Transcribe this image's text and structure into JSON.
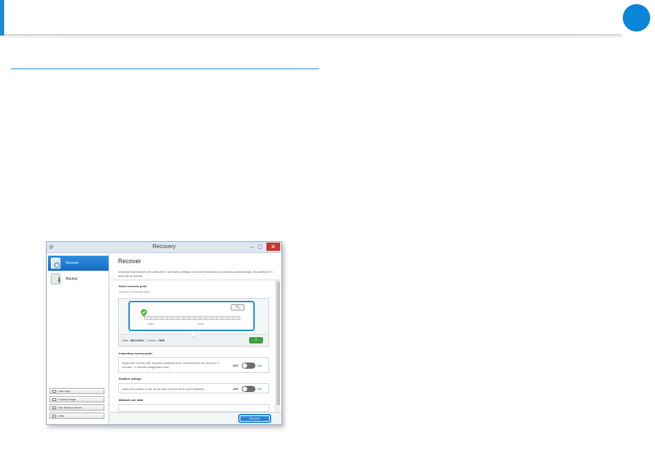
{
  "window": {
    "title": "Recovery",
    "controls": {
      "minimize": "–",
      "maximize": "□",
      "close": "✕"
    }
  },
  "sidebar": {
    "items": [
      {
        "label": "Recover",
        "icon": "recover-icon",
        "active": true
      },
      {
        "label": "Backup",
        "icon": "backup-icon",
        "active": false
      }
    ],
    "buttons": [
      {
        "label": "Disk copy"
      },
      {
        "label": "Factory image"
      },
      {
        "label": "Run Backup server"
      },
      {
        "label": "Help"
      }
    ]
  },
  "main": {
    "title": "Recover",
    "description": "A function that recovers the computer to the factory settings or recovers Windows to previously saved settings. All contents of C: drive will be deleted.",
    "select_point": {
      "title": "Select recovery point",
      "subtitle": "Recover to selected point.",
      "zoom_label": "🔍",
      "years": [
        "2012",
        "2013"
      ],
      "date_label": "Date :",
      "date_value": "08/11/2012",
      "source_label": "Source :",
      "source_value": "HDD"
    },
    "inspecting": {
      "title": "Inspecting recovery point",
      "text": "Inspection recovery file. Requires additional time. Estimated time for recovery: 3 minutes + 2 minutes (diagnostics time)",
      "off_label": "OFF",
      "on_label": "ON"
    },
    "partition": {
      "title": "Partition settings",
      "text": "When the partition is set, all the data in all the drives will be deleted.",
      "off_label": "OFF",
      "on_label": "ON"
    },
    "maintain": {
      "title": "Maintain user data"
    },
    "recover_button": "Recover"
  },
  "colors": {
    "accent": "#1a8ad4",
    "page_dot": "#0a86d8",
    "close": "#c7382e",
    "toggle_on": "#3a9b35"
  }
}
